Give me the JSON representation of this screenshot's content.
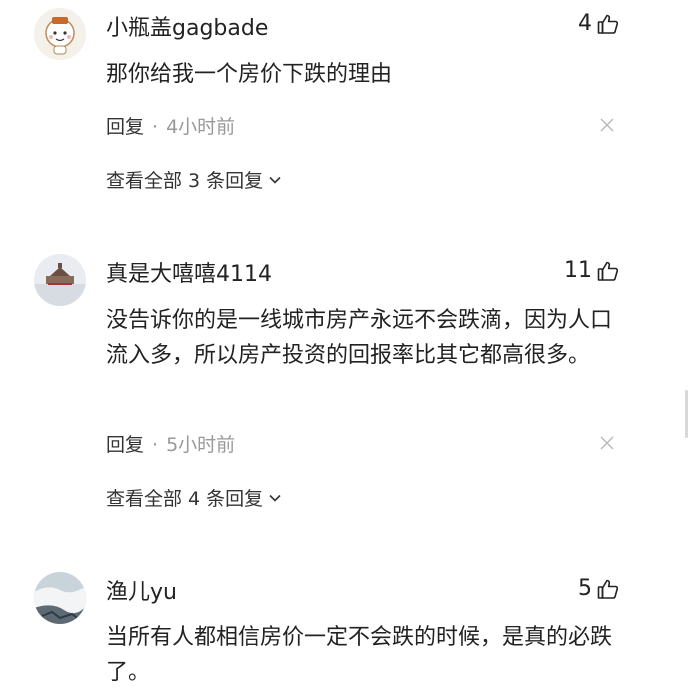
{
  "comments": [
    {
      "name": "小瓶盖gagbade",
      "likes": "4",
      "text": "那你给我一个房价下跌的理由",
      "reply_label": "回复",
      "separator": "·",
      "time": "4小时前",
      "view_all": "查看全部 3 条回复"
    },
    {
      "name": "真是大嘻嘻4114",
      "likes": "11",
      "text": "没告诉你的是一线城市房产永远不会跌滴，因为人口流入多，所以房产投资的回报率比其它都高很多。",
      "reply_label": "回复",
      "separator": "·",
      "time": "5小时前",
      "view_all": "查看全部 4 条回复"
    },
    {
      "name": "渔儿yu",
      "likes": "5",
      "text": "当所有人都相信房价一定不会跌的时候，是真的必跌了。"
    }
  ],
  "colors": {
    "text": "#222222",
    "muted": "#999999"
  }
}
